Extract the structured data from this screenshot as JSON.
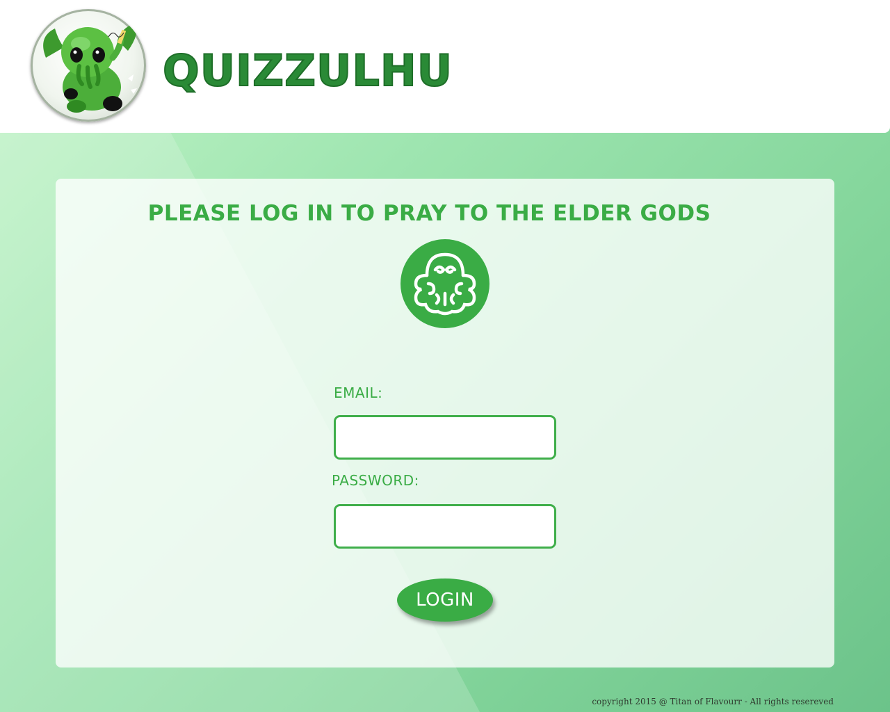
{
  "header": {
    "brand": "QUIZZULHU",
    "logo_icon": "cthulhu-mascot-icon"
  },
  "login": {
    "title": "PLEASE LOG IN TO PRAY TO THE ELDER GODS",
    "emblem_icon": "octopus-icon",
    "email_label": "EMAIL:",
    "email_value": "",
    "password_label": "PASSWORD:",
    "password_value": "",
    "submit_label": "LOGIN"
  },
  "footer": {
    "copyright": "copyright 2015 @ Titan of Flavourr - All rights resereved"
  },
  "colors": {
    "accent": "#3aac45",
    "brand_text": "#2a8a36",
    "background_start": "#c4f5c9",
    "background_end": "#6cc38a"
  }
}
